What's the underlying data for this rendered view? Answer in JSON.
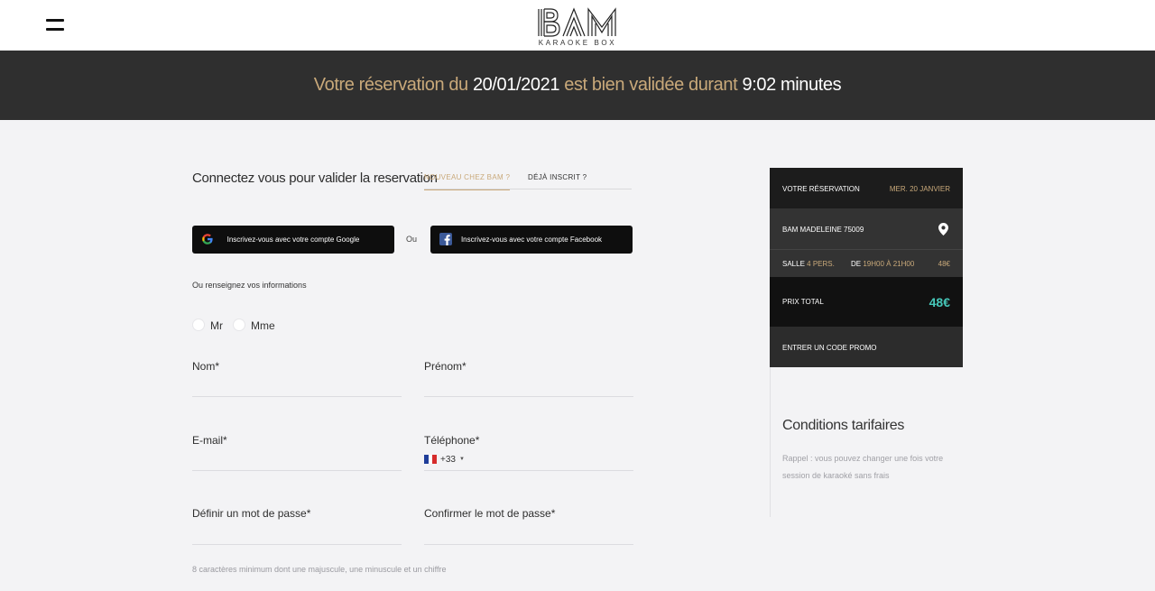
{
  "header": {
    "logo_text": "BAM",
    "logo_subtitle": "KARAOKE BOX",
    "menu_icon": "hamburger-icon"
  },
  "banner": {
    "part1": "Votre réservation du",
    "date": "20/01/2021",
    "part2": "est bien validée durant",
    "timer": "9:02",
    "part3": "minutes"
  },
  "login": {
    "title": "Connectez vous pour valider la reservation",
    "tab_new": "NOUVEAU CHEZ BAM ?",
    "tab_existing": "DÉJÀ INSCRIT ?",
    "google_button": "Inscrivez-vous avec votre compte Google",
    "or_label": "Ou",
    "facebook_button": "Inscrivez-vous avec votre compte Facebook",
    "info_label": "Ou renseignez vos informations"
  },
  "form": {
    "civility_mr": "Mr",
    "civility_mme": "Mme",
    "nom_label": "Nom*",
    "prenom_label": "Prénom*",
    "email_label": "E-mail*",
    "telephone_label": "Téléphone*",
    "phone_code": "+33",
    "password_label": "Définir un mot de passe*",
    "confirm_label": "Confirmer le mot de passe*",
    "password_hint": "8 caractères minimum dont une majuscule, une minuscule et un chiffre"
  },
  "reservation": {
    "title": "VOTRE RÉSERVATION",
    "date": "MER. 20 JANVIER",
    "location": "BAM MADELEINE 75009",
    "salle_label": "SALLE",
    "salle_value": "4 PERS.",
    "time_label": "DE",
    "time_value": "19H00 À 21H00",
    "price": "48€",
    "total_label": "PRIX TOTAL",
    "total_value": "48€",
    "promo": "ENTRER UN CODE PROMO"
  },
  "conditions": {
    "title": "Conditions tarifaires",
    "text": "Rappel : vous pouvez changer une fois votre session de karaoké sans frais"
  },
  "colors": {
    "gold": "#c9a97a",
    "teal": "#46c7b9",
    "dark": "#2f2f2f"
  }
}
